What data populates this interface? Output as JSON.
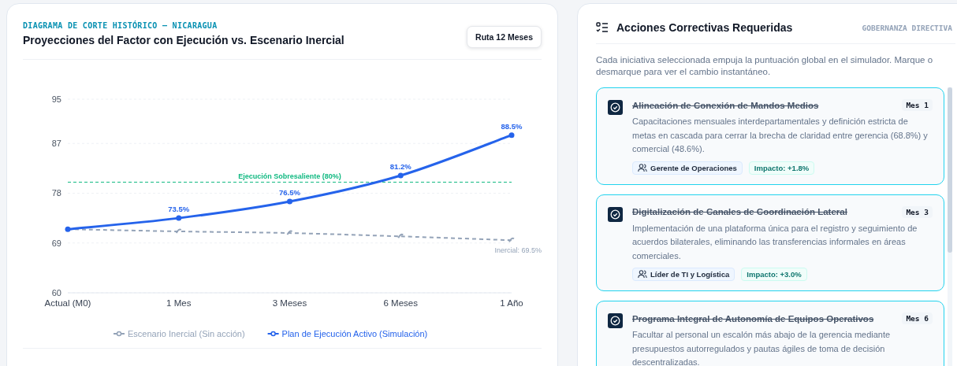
{
  "chart_panel": {
    "eyebrow": "DIAGRAMA DE CORTE HISTÓRICO — NICARAGUA",
    "title": "Proyecciones del Factor con Ejecución vs. Escenario Inercial",
    "range_button": "Ruta 12 Meses",
    "chart_data": {
      "type": "line",
      "categories": [
        "Actual (M0)",
        "1 Mes",
        "3 Meses",
        "6 Meses",
        "1 Año"
      ],
      "ylim": [
        60,
        95
      ],
      "yticks": [
        60,
        69,
        78,
        87,
        95
      ],
      "grid": true,
      "legend": true,
      "series": [
        {
          "name": "Escenario Inercial (Sin acción)",
          "color": "#94a3b8",
          "line_style": "dashed",
          "marker": "cross",
          "values": [
            71.5,
            71.1,
            70.8,
            70.2,
            69.5
          ]
        },
        {
          "name": "Plan de Ejecución Activo (Simulación)",
          "color": "#2563eb",
          "line_style": "solid",
          "marker": "circle",
          "values": [
            71.5,
            73.5,
            76.5,
            81.2,
            88.5
          ]
        }
      ],
      "ref_lines": [
        {
          "axis": "y",
          "value": 80,
          "label": "Ejecución Sobresaliente (80%)",
          "color": "#10b981"
        }
      ],
      "annotations": [
        {
          "text": "73.5%",
          "x": "1 Mes",
          "y": 73.5
        },
        {
          "text": "76.5%",
          "x": "3 Meses",
          "y": 76.5
        },
        {
          "text": "81.2%",
          "x": "6 Meses",
          "y": 81.2
        },
        {
          "text": "88.5%",
          "x": "1 Año",
          "y": 88.5
        },
        {
          "text": "Inercial: 69.5%",
          "x": "1 Año",
          "y": 69.5
        }
      ]
    }
  },
  "actions_panel": {
    "title": "Acciones Correctivas Requeridas",
    "tag": "GOBERNANZA DIRECTIVA",
    "description": "Cada iniciativa seleccionada empuja la puntuación global en el simulador. Marque o desmarque para ver el cambio instantáneo.",
    "items": [
      {
        "title": "Alineación de Conexión de Mandos Medios",
        "month": "Mes 1",
        "checked": true,
        "description": "Capacitaciones mensuales interdepartamentales y definición estricta de metas en cascada para cerrar la brecha de claridad entre gerencia (68.8%) y comercial (48.6%).",
        "owner": "Gerente de Operaciones",
        "impact": "Impacto: +1.8%"
      },
      {
        "title": "Digitalización de Canales de Coordinación Lateral",
        "month": "Mes 3",
        "checked": true,
        "description": "Implementación de una plataforma única para el registro y seguimiento de acuerdos bilaterales, eliminando las transferencias informales en áreas comerciales.",
        "owner": "Líder de TI y Logística",
        "impact": "Impacto: +3.0%"
      },
      {
        "title": "Programa Integral de Autonomía de Equipos Operativos",
        "month": "Mes 6",
        "checked": true,
        "description": "Facultar al personal un escalón más abajo de la gerencia mediante presupuestos autorregulados y pautas ágiles de toma de decisión descentralizadas."
      }
    ]
  }
}
